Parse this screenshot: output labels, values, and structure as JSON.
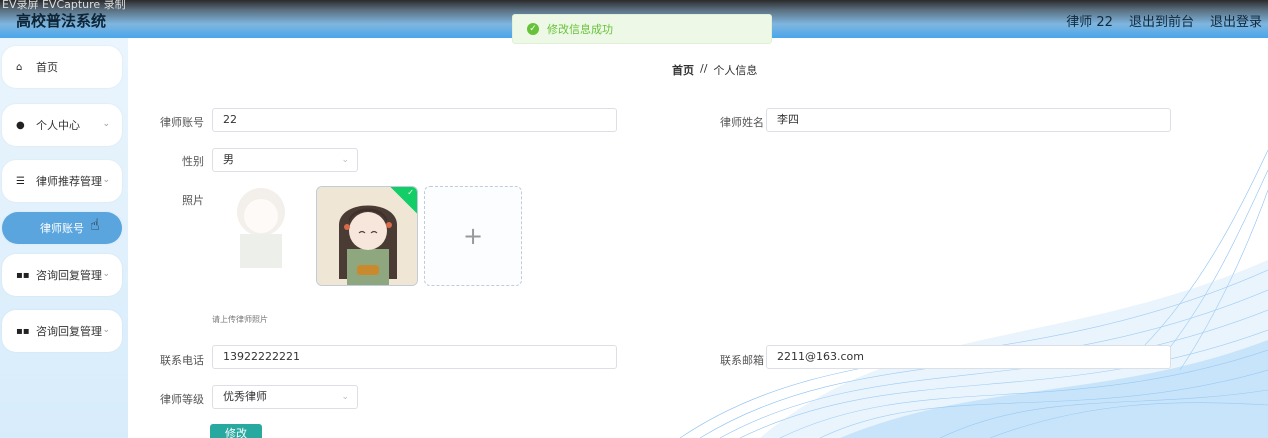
{
  "capture_title": "EV录屏 EVCapture 录制",
  "app_title": "高校普法系统",
  "top_links": [
    "律师 22",
    "退出到前台",
    "退出登录"
  ],
  "toast": "修改信息成功",
  "sidebar": {
    "items": [
      {
        "label": "首页",
        "icon": "home-icon"
      },
      {
        "label": "个人中心",
        "icon": "user-icon"
      },
      {
        "label": "律师推荐管理",
        "icon": "list-icon"
      },
      {
        "label": "律师账号"
      },
      {
        "label": "咨询回复管理",
        "icon": "grid-icon"
      },
      {
        "label": "咨询回复管理",
        "icon": "grid-icon"
      }
    ]
  },
  "breadcrumb": {
    "home": "首页",
    "sep": "//",
    "current": "个人信息"
  },
  "form": {
    "account_label": "律师账号",
    "account_value": "22",
    "name_label": "律师姓名",
    "name_value": "李四",
    "gender_label": "性别",
    "gender_value": "男",
    "photo_label": "照片",
    "upload_tip": "请上传律师照片",
    "phone_label": "联系电话",
    "phone_value": "13922222221",
    "email_label": "联系邮箱",
    "email_value": "2211@163.com",
    "level_label": "律师等级",
    "level_value": "优秀律师",
    "submit": "修改"
  },
  "colors": {
    "accent": "#49a6ea",
    "success": "#67c23a",
    "button": "#27a9a0"
  }
}
